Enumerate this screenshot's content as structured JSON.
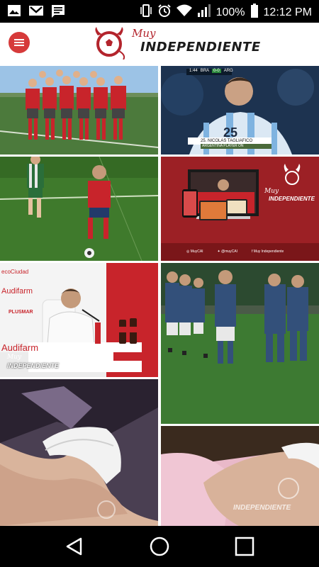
{
  "status_bar": {
    "battery_percent": "100%",
    "time": "12:12 PM",
    "left_icons": [
      "image-icon",
      "gmail-icon",
      "message-icon"
    ],
    "right_icons": [
      "vibrate-icon",
      "alarm-icon",
      "wifi-icon",
      "signal-icon",
      "battery-icon"
    ]
  },
  "app_bar": {
    "menu_icon": "hamburger-menu-icon",
    "logo_small": "Muy",
    "logo_big": "INDEPENDIENTE"
  },
  "tiles": {
    "t2": {
      "scoreboard_time": "1:44",
      "scoreboard_home": "BRA",
      "scoreboard_score": "0-0",
      "scoreboard_away": "ARG",
      "jersey_number": "25",
      "caption_name": "25. NICOLAS TAGLIAFICO",
      "caption_sub": "ARGENTINA  PLAYER ON"
    },
    "t4": {
      "logo_small": "Muy",
      "logo_big": "INDEPENDIENTE",
      "social_instagram": "MuyCAI",
      "social_twitter": "@muyCAI",
      "social_facebook": "Muy Independiente"
    },
    "t5": {
      "banner_text_1": "Audifarm",
      "banner_text_2": "Audifarm",
      "banner_text_3": "PLUSMAR",
      "banner_text_4": "ecoCiudad",
      "watermark_small": "Muy",
      "watermark_big": "INDEPENDIENTE"
    },
    "t8": {
      "watermark_big": "INDEPENDIENTE"
    }
  },
  "nav_bar": {
    "back_icon": "back-triangle-icon",
    "home_icon": "home-circle-icon",
    "recents_icon": "recents-square-icon"
  },
  "colors": {
    "brand_red": "#d63a3a",
    "dark_red": "#8e1b1f"
  }
}
